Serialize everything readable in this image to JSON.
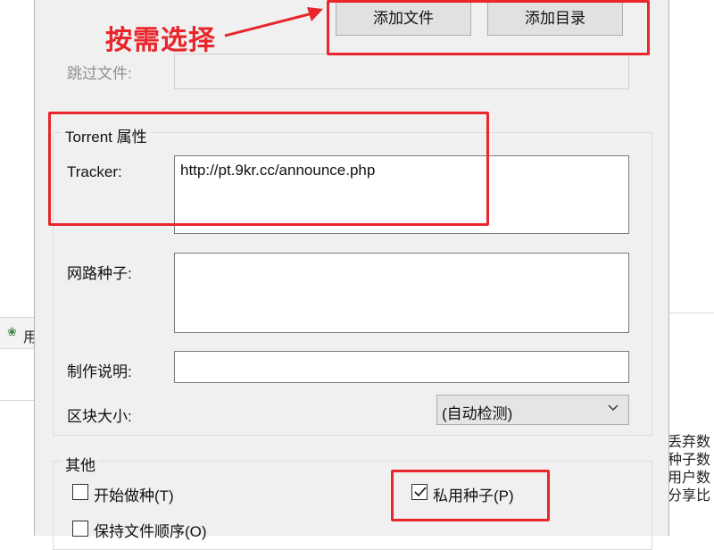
{
  "background": {
    "left_label": "用",
    "right_lines": [
      "丢弃数",
      "种子数",
      "用户数",
      "分享比"
    ]
  },
  "dialog": {
    "add_file_label": "添加文件",
    "add_dir_label": "添加目录",
    "skip_files_label": "跳过文件:",
    "skip_files_value": "",
    "torrent_group_title": "Torrent 属性",
    "tracker_label": "Tracker:",
    "tracker_value": "http://pt.9kr.cc/announce.php",
    "web_seed_label": "网路种子:",
    "web_seed_value": "",
    "comment_label": "制作说明:",
    "comment_value": "",
    "piece_size_label": "区块大小:",
    "piece_size_value": "(自动检测)",
    "other_group_title": "其他",
    "start_seeding_label": "开始做种(T)",
    "start_seeding_checked": false,
    "private_label": "私用种子(P)",
    "private_checked": true,
    "preserve_order_label": "保持文件顺序(O)",
    "preserve_order_checked": false
  },
  "annotation": {
    "text": "按需选择",
    "color": "#e8262b"
  }
}
